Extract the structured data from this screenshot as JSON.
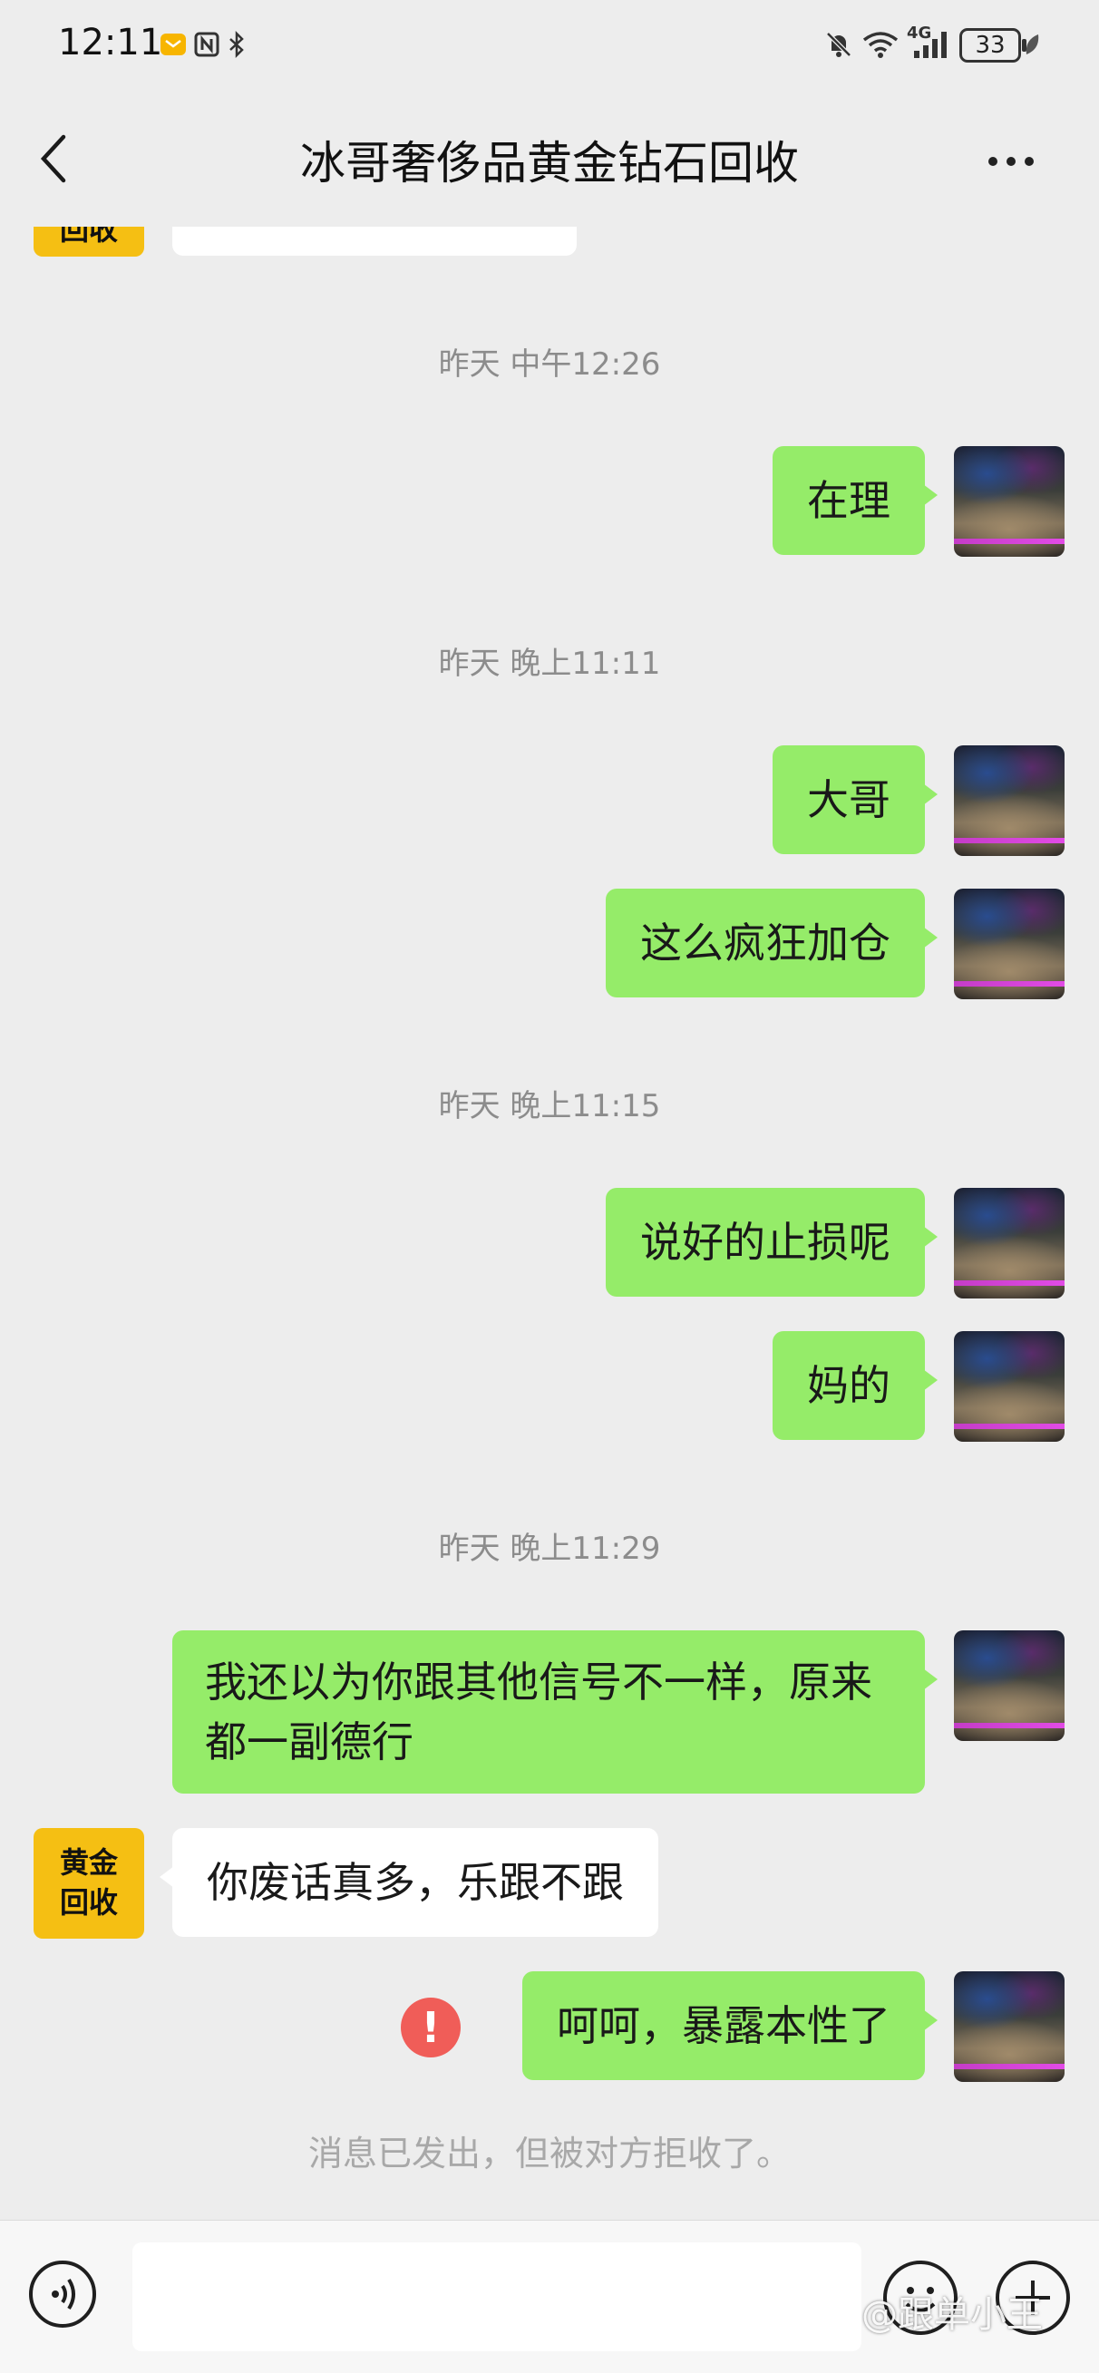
{
  "status_bar": {
    "time": "12:11",
    "network_label": "4G",
    "battery": "33"
  },
  "header": {
    "title": "冰哥奢侈品黄金钻石回收"
  },
  "contact": {
    "avatar_text_line1": "黄金",
    "avatar_text_line2": "回收",
    "partial_avatar_text": "回收"
  },
  "timestamps": [
    "昨天 中午12:26",
    "昨天 晚上11:11",
    "昨天 晚上11:15",
    "昨天 晚上11:29"
  ],
  "messages": [
    {
      "sender": "me",
      "text": "在理"
    },
    {
      "sender": "me",
      "text": "大哥"
    },
    {
      "sender": "me",
      "text": "这么疯狂加仓"
    },
    {
      "sender": "me",
      "text": "说好的止损呢"
    },
    {
      "sender": "me",
      "text": "妈的"
    },
    {
      "sender": "me",
      "text": "我还以为你跟其他信号不一样，原来都一副德行"
    },
    {
      "sender": "contact",
      "text": "你废话真多，乐跟不跟"
    },
    {
      "sender": "me",
      "text": "呵呵，暴露本性了",
      "status": "failed"
    }
  ],
  "system_notice": "消息已发出，但被对方拒收了。",
  "error_mark": "!",
  "watermark": "@跟单小王",
  "colors": {
    "background": "#ededed",
    "my_bubble": "#95ec69",
    "their_bubble": "#ffffff",
    "error": "#f05d58",
    "shop_avatar": "#f5bf13"
  }
}
